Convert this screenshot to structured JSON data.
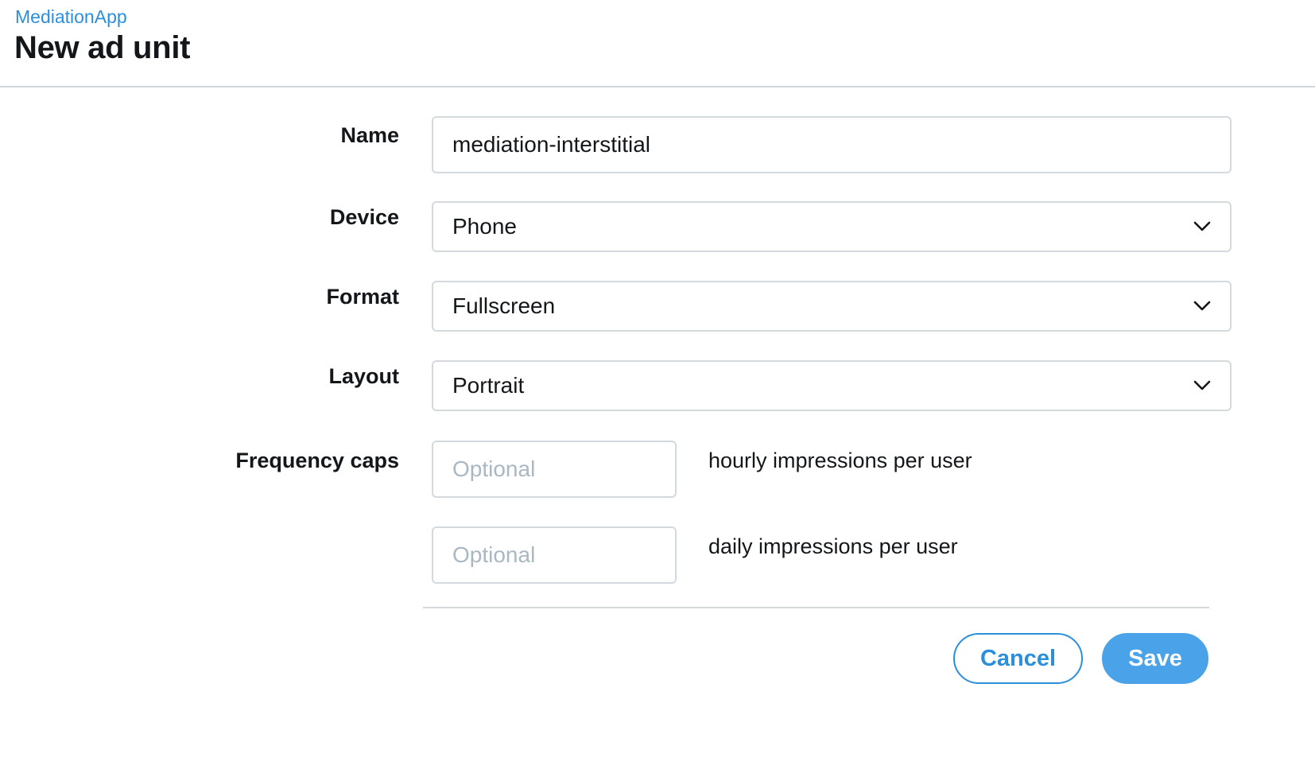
{
  "header": {
    "breadcrumb": "MediationApp",
    "title": "New ad unit"
  },
  "form": {
    "name": {
      "label": "Name",
      "value": "mediation-interstitial"
    },
    "device": {
      "label": "Device",
      "selected": "Phone",
      "icon": "chevron-down-icon"
    },
    "format": {
      "label": "Format",
      "selected": "Fullscreen",
      "icon": "chevron-down-icon"
    },
    "layout": {
      "label": "Layout",
      "selected": "Portrait",
      "icon": "chevron-down-icon"
    },
    "frequency_caps": {
      "label": "Frequency caps",
      "hourly": {
        "placeholder": "Optional",
        "value": "",
        "suffix": "hourly impressions per user"
      },
      "daily": {
        "placeholder": "Optional",
        "value": "",
        "suffix": "daily impressions per user"
      }
    }
  },
  "actions": {
    "cancel_label": "Cancel",
    "save_label": "Save"
  },
  "colors": {
    "accent": "#2b8fdc",
    "save_bg": "#4aa3e8",
    "border": "#d4d9de",
    "placeholder": "#aab8c2",
    "text": "#14171a"
  }
}
